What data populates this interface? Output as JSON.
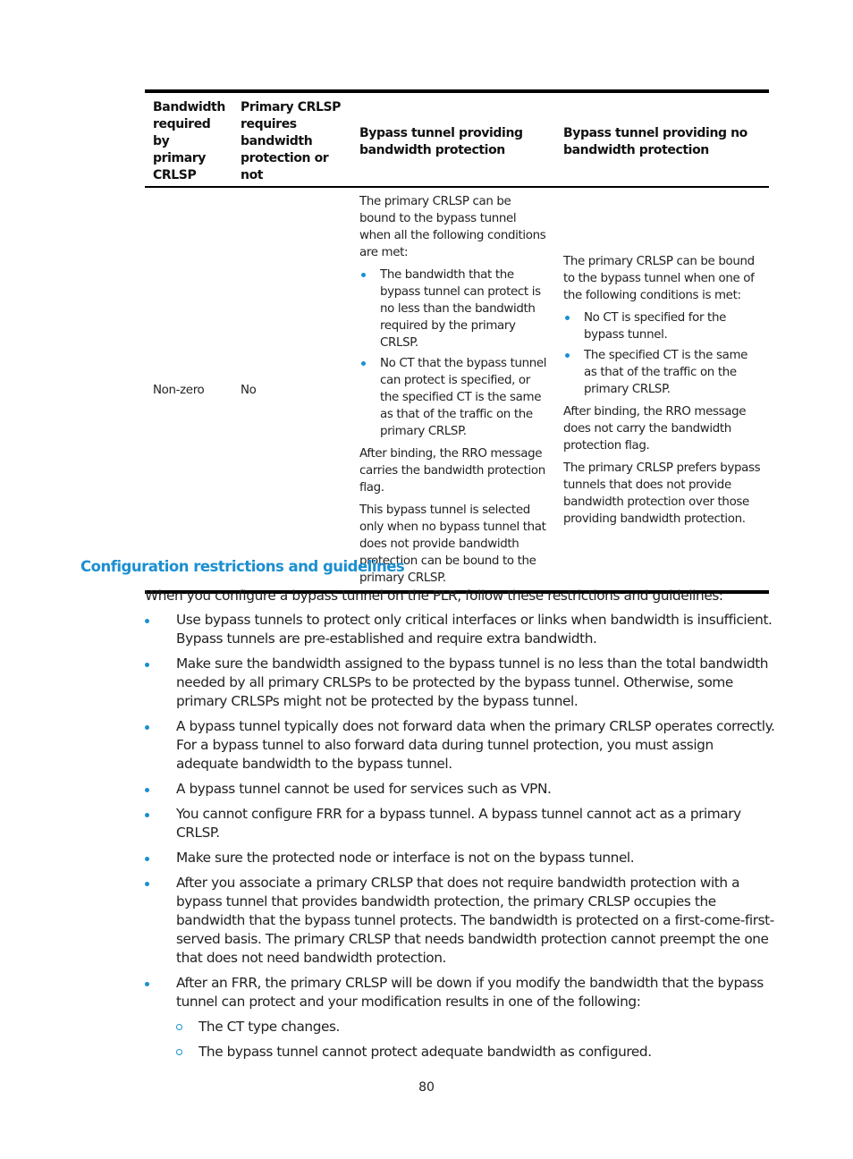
{
  "table": {
    "headers": [
      "Bandwidth required by primary CRLSP",
      "Primary CRLSP requires bandwidth protection or not",
      "Bypass tunnel providing bandwidth protection",
      "Bypass tunnel providing no bandwidth protection"
    ],
    "rows": [
      {
        "bandwidth_required": "Non-zero",
        "requires_protection": "No",
        "with_protection": {
          "intro": "The primary CRLSP can be bound to the bypass tunnel when all the following conditions are met:",
          "conditions": [
            "The bandwidth that the bypass tunnel can protect is no less than the bandwidth required by the primary CRLSP.",
            "No CT that the bypass tunnel can protect is specified, or the specified CT is the same as that of the traffic on the primary CRLSP."
          ],
          "notes": [
            "After binding, the RRO message carries the bandwidth protection flag.",
            "This bypass tunnel is selected only when no bypass tunnel that does not provide bandwidth protection can be bound to the primary CRLSP."
          ]
        },
        "without_protection": {
          "intro": "The primary CRLSP can be bound to the bypass tunnel when one of the following conditions is met:",
          "conditions": [
            "No CT is specified for the bypass tunnel.",
            "The specified CT is the same as that of the traffic on the primary CRLSP."
          ],
          "notes": [
            "After binding, the RRO message does not carry the bandwidth protection flag.",
            "The primary CRLSP prefers bypass tunnels that does not provide bandwidth protection over those providing bandwidth protection."
          ]
        }
      }
    ]
  },
  "section": {
    "heading": "Configuration restrictions and guidelines",
    "intro": "When you configure a bypass tunnel on the PLR, follow these restrictions and guidelines:",
    "bullets": [
      {
        "text": "Use bypass tunnels to protect only critical interfaces or links when bandwidth is insufficient. Bypass tunnels are pre-established and require extra bandwidth."
      },
      {
        "text": "Make sure the bandwidth assigned to the bypass tunnel is no less than the total bandwidth needed by all primary CRLSPs to be protected by the bypass tunnel. Otherwise, some primary CRLSPs might not be protected by the bypass tunnel."
      },
      {
        "text": "A bypass tunnel typically does not forward data when the primary CRLSP operates correctly. For a bypass tunnel to also forward data during tunnel protection, you must assign adequate bandwidth to the bypass tunnel."
      },
      {
        "text": "A bypass tunnel cannot be used for services such as VPN."
      },
      {
        "text": "You cannot configure FRR for a bypass tunnel. A bypass tunnel cannot act as a primary CRLSP."
      },
      {
        "text": "Make sure the protected node or interface is not on the bypass tunnel."
      },
      {
        "text": "After you associate a primary CRLSP that does not require bandwidth protection with a bypass tunnel that provides bandwidth protection, the primary CRLSP occupies the bandwidth that the bypass tunnel protects. The bandwidth is protected on a first-come-first-served basis. The primary CRLSP that needs bandwidth protection cannot preempt the one that does not need bandwidth protection."
      },
      {
        "text": "After an FRR, the primary CRLSP will be down if you modify the bandwidth that the bypass tunnel can protect and your modification results in one of the following:",
        "sub": [
          "The CT type changes.",
          "The bypass tunnel cannot protect adequate bandwidth as configured."
        ]
      }
    ]
  },
  "footer": {
    "page_number": "80"
  },
  "colors": {
    "accent": "#1b8fd1",
    "text": "#222222",
    "rule": "#000000"
  }
}
